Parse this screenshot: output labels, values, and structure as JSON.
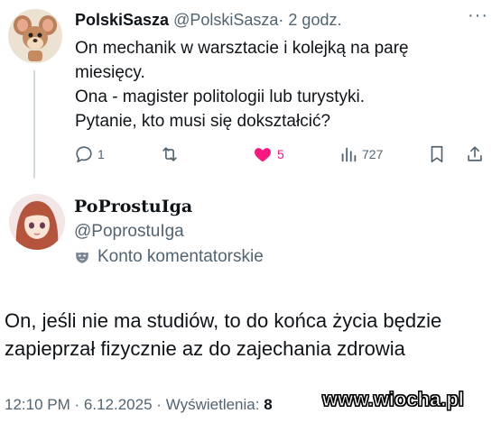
{
  "tweet": {
    "display_name": "PolskiSasza",
    "handle": "@PolskiSasza",
    "separator": "·",
    "time": "2 godz.",
    "lines": [
      "On mechanik w warsztacie i kolejką na parę",
      "miesięcy.",
      "Ona - magister politologii lub turystyki.",
      "Pytanie, kto musi się dokształcić?"
    ],
    "actions": {
      "replies": "1",
      "reposts": "",
      "likes": "5",
      "views": "727"
    },
    "menu": "···"
  },
  "reply": {
    "display_name": "PoProstuIga",
    "handle": "@PoprostuIga",
    "account_label": "Konto komentatorskie",
    "lines": [
      "On, jeśli nie ma studiów, to do końca życia będzie",
      "zapieprzał fizycznie az do zajechania zdrowia"
    ],
    "footer": {
      "time": "12:10 PM",
      "sep1": "·",
      "date": "6.12.2025",
      "sep2": "·",
      "views_label": "Wyświetlenia:",
      "views_value": "8"
    }
  },
  "watermark": "www.wiocha.pl",
  "colors": {
    "text": "#0f1419",
    "secondary": "#536471",
    "like": "#f91880",
    "thread_line": "#cfd9de"
  }
}
